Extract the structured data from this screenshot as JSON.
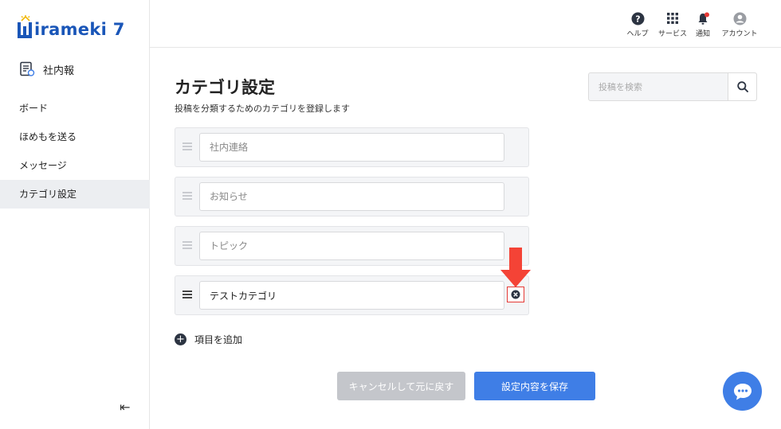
{
  "app": {
    "logo_text": "irameki 7",
    "section_label": "社内報"
  },
  "sidebar": {
    "items": [
      {
        "label": "ボード"
      },
      {
        "label": "ほめもを送る"
      },
      {
        "label": "メッセージ"
      },
      {
        "label": "カテゴリ設定",
        "active": true
      }
    ],
    "collapse_symbol": "⇤"
  },
  "header": {
    "icons": [
      {
        "label": "ヘルプ",
        "icon": "help-icon"
      },
      {
        "label": "サービス",
        "icon": "grid-icon"
      },
      {
        "label": "通知",
        "icon": "bell-icon"
      },
      {
        "label": "アカウント",
        "icon": "account-icon"
      }
    ]
  },
  "main": {
    "title": "カテゴリ設定",
    "subtitle": "投稿を分類するためのカテゴリを登録します",
    "search": {
      "placeholder": "投稿を検索"
    },
    "categories": [
      {
        "placeholder": "社内連絡",
        "value": ""
      },
      {
        "placeholder": "お知らせ",
        "value": ""
      },
      {
        "placeholder": "トピック",
        "value": ""
      },
      {
        "placeholder": "",
        "value": "テストカテゴリ"
      }
    ],
    "add_label": "項目を追加",
    "cancel_label": "キャンセルして元に戻す",
    "save_label": "設定内容を保存"
  },
  "colors": {
    "brand": "#1a56b8",
    "primary_button": "#3f7ee6",
    "disabled_button": "#c4c6cb",
    "highlight": "#e53935"
  }
}
